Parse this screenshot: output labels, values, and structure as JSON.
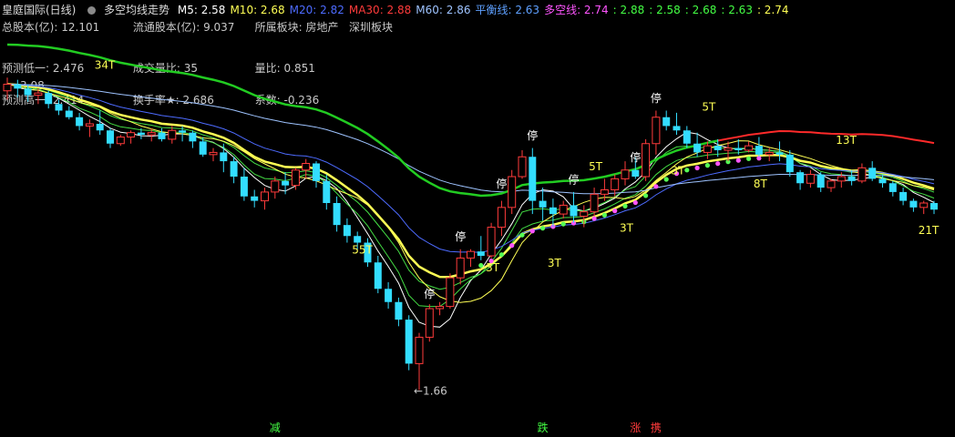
{
  "header": {
    "stock": "皇庭国际(日线)",
    "indicator": "多空均线走势",
    "icon": "circle-indicator-icon",
    "ma": [
      {
        "label": "M5:",
        "value": "2.58",
        "color": "#ffffff"
      },
      {
        "label": "M10:",
        "value": "2.68",
        "color": "#ffff55"
      },
      {
        "label": "M20:",
        "value": "2.82",
        "color": "#4d6bff"
      },
      {
        "label": "MA30:",
        "value": "2.88",
        "color": "#ff3b3b"
      },
      {
        "label": "M60:",
        "value": "2.86",
        "color": "#9ec3ff"
      },
      {
        "label": "平衡线:",
        "value": "2.63",
        "color": "#5ea0ff"
      },
      {
        "label": "多空线:",
        "value": "2.74",
        "color": "#ff55ff"
      }
    ],
    "extra_values": [
      "2.88",
      "2.58",
      "2.68",
      "2.63",
      "2.74"
    ],
    "extra_colors": [
      "#44ff44",
      "#44ff44",
      "#44ff44",
      "#44ff44",
      "#ffff55"
    ]
  },
  "info": {
    "total_shares_label": "总股本(亿):",
    "total_shares": "12.101",
    "float_shares_label": "流通股本(亿):",
    "float_shares": "9.037",
    "sector_label": "所属板块:",
    "sector1": "房地产",
    "sector2": "深圳板块",
    "forecast_low_label": "预测低一:",
    "forecast_low": "2.476",
    "volume_label": "成交量比:",
    "volume_ratio": "35",
    "qty_ratio_label": "量比:",
    "qty_ratio": "0.851",
    "forecast_high_label": "预测高一:",
    "forecast_high": "2.414",
    "turnover_label": "换手率★:",
    "turnover": "2.686",
    "coef_label": "系数:",
    "coef": "-0.236",
    "partial_number": "3.08"
  },
  "chart_data": {
    "type": "candlestick",
    "ylim": [
      1.55,
      3.35
    ],
    "candles": [
      [
        3.02,
        3.08,
        2.98,
        3.05
      ],
      [
        3.05,
        3.07,
        2.99,
        3.03
      ],
      [
        3.03,
        3.05,
        2.97,
        3.0
      ],
      [
        3.0,
        3.03,
        2.96,
        3.01
      ],
      [
        3.01,
        3.02,
        2.94,
        2.96
      ],
      [
        2.96,
        2.98,
        2.91,
        2.93
      ],
      [
        2.93,
        2.95,
        2.89,
        2.9
      ],
      [
        2.9,
        2.92,
        2.84,
        2.86
      ],
      [
        2.86,
        2.89,
        2.81,
        2.87
      ],
      [
        2.87,
        2.93,
        2.82,
        2.84
      ],
      [
        2.84,
        2.85,
        2.76,
        2.78
      ],
      [
        2.78,
        2.82,
        2.77,
        2.81
      ],
      [
        2.81,
        2.84,
        2.78,
        2.83
      ],
      [
        2.83,
        2.85,
        2.8,
        2.82
      ],
      [
        2.82,
        2.85,
        2.79,
        2.83
      ],
      [
        2.83,
        2.85,
        2.79,
        2.8
      ],
      [
        2.8,
        2.86,
        2.78,
        2.84
      ],
      [
        2.84,
        2.86,
        2.79,
        2.83
      ],
      [
        2.83,
        2.84,
        2.76,
        2.79
      ],
      [
        2.79,
        2.81,
        2.72,
        2.73
      ],
      [
        2.73,
        2.76,
        2.7,
        2.74
      ],
      [
        2.74,
        2.78,
        2.65,
        2.7
      ],
      [
        2.7,
        2.72,
        2.6,
        2.63
      ],
      [
        2.63,
        2.67,
        2.52,
        2.54
      ],
      [
        2.54,
        2.57,
        2.49,
        2.52
      ],
      [
        2.52,
        2.58,
        2.48,
        2.56
      ],
      [
        2.56,
        2.63,
        2.53,
        2.61
      ],
      [
        2.61,
        2.65,
        2.55,
        2.59
      ],
      [
        2.59,
        2.67,
        2.57,
        2.66
      ],
      [
        2.66,
        2.71,
        2.62,
        2.69
      ],
      [
        2.69,
        2.7,
        2.58,
        2.61
      ],
      [
        2.61,
        2.64,
        2.48,
        2.51
      ],
      [
        2.51,
        2.54,
        2.38,
        2.41
      ],
      [
        2.41,
        2.44,
        2.33,
        2.36
      ],
      [
        2.36,
        2.38,
        2.3,
        2.33
      ],
      [
        2.33,
        2.35,
        2.22,
        2.24
      ],
      [
        2.24,
        2.27,
        2.1,
        2.12
      ],
      [
        2.12,
        2.15,
        2.03,
        2.06
      ],
      [
        2.06,
        2.08,
        1.95,
        1.98
      ],
      [
        1.98,
        2.0,
        1.75,
        1.78
      ],
      [
        1.78,
        1.92,
        1.66,
        1.9
      ],
      [
        1.9,
        2.05,
        1.88,
        2.03
      ],
      [
        2.03,
        2.06,
        2.0,
        2.04
      ],
      [
        2.04,
        2.19,
        2.03,
        2.17
      ],
      [
        2.17,
        2.3,
        2.14,
        2.26
      ],
      [
        2.26,
        2.3,
        2.22,
        2.29
      ],
      [
        2.29,
        2.36,
        2.25,
        2.27
      ],
      [
        2.27,
        2.42,
        2.26,
        2.4
      ],
      [
        2.4,
        2.52,
        2.36,
        2.49
      ],
      [
        2.49,
        2.66,
        2.46,
        2.63
      ],
      [
        2.63,
        2.75,
        2.62,
        2.72
      ],
      [
        2.72,
        2.76,
        2.46,
        2.52
      ],
      [
        2.52,
        2.58,
        2.43,
        2.49
      ],
      [
        2.49,
        2.53,
        2.4,
        2.46
      ],
      [
        2.46,
        2.52,
        2.44,
        2.5
      ],
      [
        2.5,
        2.56,
        2.42,
        2.45
      ],
      [
        2.45,
        2.5,
        2.4,
        2.47
      ],
      [
        2.47,
        2.58,
        2.45,
        2.55
      ],
      [
        2.55,
        2.62,
        2.52,
        2.57
      ],
      [
        2.57,
        2.64,
        2.54,
        2.62
      ],
      [
        2.62,
        2.7,
        2.59,
        2.66
      ],
      [
        2.66,
        2.72,
        2.62,
        2.63
      ],
      [
        2.63,
        2.8,
        2.61,
        2.78
      ],
      [
        2.78,
        2.93,
        2.73,
        2.9
      ],
      [
        2.9,
        2.93,
        2.84,
        2.86
      ],
      [
        2.86,
        2.92,
        2.82,
        2.84
      ],
      [
        2.84,
        2.86,
        2.76,
        2.78
      ],
      [
        2.78,
        2.83,
        2.72,
        2.74
      ],
      [
        2.74,
        2.79,
        2.71,
        2.77
      ],
      [
        2.77,
        2.8,
        2.72,
        2.75
      ],
      [
        2.75,
        2.79,
        2.7,
        2.76
      ],
      [
        2.76,
        2.8,
        2.73,
        2.75
      ],
      [
        2.75,
        2.79,
        2.74,
        2.77
      ],
      [
        2.77,
        2.81,
        2.72,
        2.73
      ],
      [
        2.73,
        2.76,
        2.7,
        2.74
      ],
      [
        2.74,
        2.79,
        2.7,
        2.73
      ],
      [
        2.73,
        2.75,
        2.63,
        2.65
      ],
      [
        2.65,
        2.66,
        2.57,
        2.6
      ],
      [
        2.6,
        2.66,
        2.58,
        2.64
      ],
      [
        2.64,
        2.65,
        2.56,
        2.58
      ],
      [
        2.58,
        2.62,
        2.56,
        2.61
      ],
      [
        2.61,
        2.65,
        2.58,
        2.63
      ],
      [
        2.63,
        2.66,
        2.59,
        2.61
      ],
      [
        2.61,
        2.69,
        2.6,
        2.67
      ],
      [
        2.67,
        2.7,
        2.61,
        2.62
      ],
      [
        2.62,
        2.64,
        2.58,
        2.6
      ],
      [
        2.6,
        2.61,
        2.54,
        2.56
      ],
      [
        2.56,
        2.58,
        2.5,
        2.52
      ],
      [
        2.52,
        2.53,
        2.47,
        2.49
      ],
      [
        2.49,
        2.52,
        2.46,
        2.51
      ],
      [
        2.51,
        2.52,
        2.46,
        2.48
      ]
    ],
    "annotations": [
      {
        "label": "34T",
        "i": 9,
        "price": 3.12,
        "color": "#ffff55"
      },
      {
        "label": "55T",
        "i": 34,
        "price": 2.28,
        "color": "#ffff55"
      },
      {
        "label": "停",
        "i": 48,
        "price": 2.58,
        "color": "#ffffff"
      },
      {
        "label": "停",
        "i": 51,
        "price": 2.8,
        "color": "#ffffff"
      },
      {
        "label": "停",
        "i": 55,
        "price": 2.6,
        "color": "#ffffff"
      },
      {
        "label": "停",
        "i": 61,
        "price": 2.7,
        "color": "#ffffff"
      },
      {
        "label": "停",
        "i": 63,
        "price": 2.97,
        "color": "#ffffff"
      },
      {
        "label": "停",
        "i": 44,
        "price": 2.34,
        "color": "#ffffff"
      },
      {
        "label": "停",
        "i": 41,
        "price": 2.08,
        "color": "#ffffff"
      },
      {
        "label": "3T",
        "i": 47,
        "price": 2.2,
        "color": "#ffff55"
      },
      {
        "label": "3T",
        "i": 53,
        "price": 2.22,
        "color": "#ffff55"
      },
      {
        "label": "3T",
        "i": 60,
        "price": 2.38,
        "color": "#ffff55"
      },
      {
        "label": "3T",
        "i": 65,
        "price": 2.64,
        "color": "#ffff55"
      },
      {
        "label": "5T",
        "i": 57,
        "price": 2.66,
        "color": "#ffff55"
      },
      {
        "label": "5T",
        "i": 68,
        "price": 2.93,
        "color": "#ffff55"
      },
      {
        "label": "8T",
        "i": 73,
        "price": 2.58,
        "color": "#ffff55"
      },
      {
        "label": "13T",
        "i": 81,
        "price": 2.78,
        "color": "#ffff55"
      },
      {
        "label": "21T",
        "i": 89,
        "price": 2.37,
        "color": "#ffff55"
      },
      {
        "label": "←1.66",
        "i": 40,
        "price": 1.64,
        "color": "#c8c8c8"
      }
    ],
    "bottom_signals": [
      {
        "label": "减",
        "i": 26,
        "color": "#44ff44"
      },
      {
        "label": "跌",
        "i": 52,
        "color": "#44ff44"
      },
      {
        "label": "涨",
        "i": 61,
        "color": "#ff3b3b"
      },
      {
        "label": "携",
        "i": 63,
        "color": "#ff3b3b"
      }
    ]
  }
}
